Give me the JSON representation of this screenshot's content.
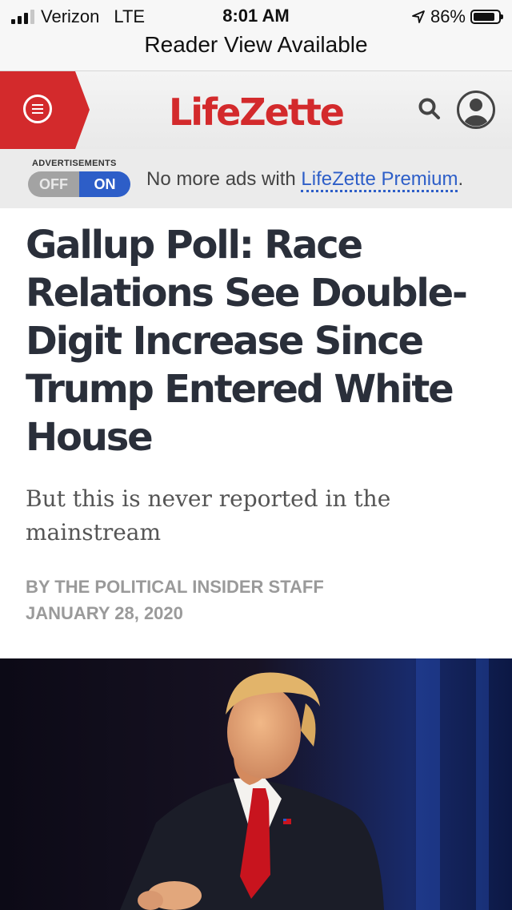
{
  "status_bar": {
    "carrier": "Verizon",
    "network": "LTE",
    "time": "8:01 AM",
    "battery": "86%",
    "battery_level": 0.86
  },
  "reader_view": "Reader View Available",
  "site": {
    "logo": "LifeZette",
    "brand_color": "#d32a2c"
  },
  "ads": {
    "label": "ADVERTISEMENTS",
    "toggle_off": "OFF",
    "toggle_on": "ON",
    "message": "No more ads with ",
    "link": "LifeZette Premium",
    "suffix": "."
  },
  "article": {
    "headline": "Gallup Poll: Race Relations See Double-Digit Increase Since Trump Entered White House",
    "subheadline": "But this is never reported in the mainstream",
    "byline": "BY THE POLITICAL INSIDER STAFF",
    "date": "JANUARY 28, 2020"
  },
  "icons": {
    "menu": "menu-icon",
    "search": "search-icon",
    "user": "user-icon",
    "location": "location-arrow-icon"
  }
}
